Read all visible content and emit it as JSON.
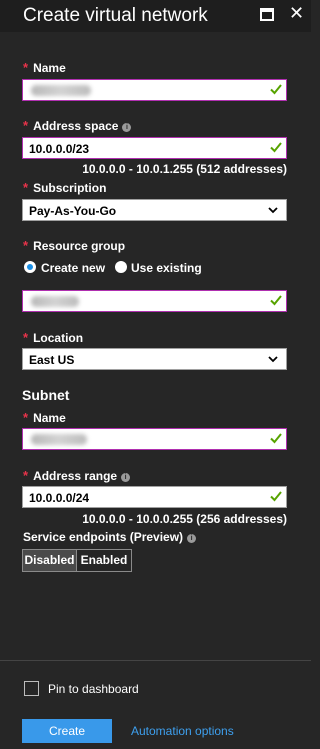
{
  "blade": {
    "title": "Create virtual network"
  },
  "fields": {
    "name_label": "Name",
    "address_space_label": "Address space",
    "address_space_value": "10.0.0.0/23",
    "address_space_range": "10.0.0.0 - 10.0.1.255 (512 addresses)",
    "subscription_label": "Subscription",
    "subscription_value": "Pay-As-You-Go",
    "resource_group_label": "Resource group",
    "rg_create_new": "Create new",
    "rg_use_existing": "Use existing",
    "location_label": "Location",
    "location_value": "East US"
  },
  "subnet": {
    "heading": "Subnet",
    "name_label": "Name",
    "address_range_label": "Address range",
    "address_range_value": "10.0.0.0/24",
    "address_range_summary": "10.0.0.0 - 10.0.0.255 (256 addresses)",
    "service_endpoints_label": "Service endpoints (Preview)",
    "disabled_label": "Disabled",
    "enabled_label": "Enabled"
  },
  "footer": {
    "pin_label": "Pin to dashboard",
    "create_label": "Create",
    "automation_label": "Automation options"
  },
  "required_mark": "*",
  "info_glyph": "i",
  "colors": {
    "accent": "#3999ea",
    "link": "#3ea0ef",
    "valid": "#57a300",
    "required": "#e8334a",
    "focus_border": "#b02fb0"
  }
}
